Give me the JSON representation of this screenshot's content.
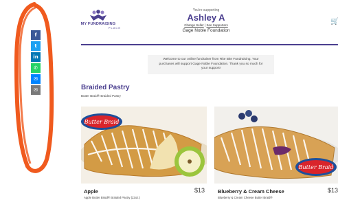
{
  "share": {
    "buttons": [
      {
        "icon": "facebook-icon",
        "glyph": "f",
        "color": "#3b5998"
      },
      {
        "icon": "twitter-icon",
        "glyph": "t",
        "color": "#1da1f2"
      },
      {
        "icon": "linkedin-icon",
        "glyph": "in",
        "color": "#0077b5"
      },
      {
        "icon": "whatsapp-icon",
        "glyph": "✆",
        "color": "#25d366"
      },
      {
        "icon": "messenger-icon",
        "glyph": "✉",
        "color": "#0084ff"
      },
      {
        "icon": "email-icon",
        "glyph": "✉",
        "color": "#7a7a7a"
      }
    ]
  },
  "header": {
    "logo_text": "MY FUNDRAISING",
    "logo_sub": "PLACE",
    "supporting_label": "You're supporting",
    "seller_name": "Ashley A",
    "change_seller": "Change Seller",
    "separator": "|",
    "see_supporters": "See Supporters",
    "organization": "Gage Noble Foundation",
    "cart_icon": "cart-icon"
  },
  "welcome": {
    "line1": "Welcome to our online fundraiser from Rite Bite Fundraising. Your",
    "line2": "purchases will support Gage Noble Foundation. Thank you so much for",
    "line3": "your support!"
  },
  "section": {
    "title": "Braided Pastry",
    "subtitle": "Butter Braid® Braided Pastry"
  },
  "products": [
    {
      "name": "Apple",
      "price": "$13",
      "description": "Apple Butter Braid® Braided Pastry (22oz.)",
      "badge": "Butter Braid"
    },
    {
      "name": "Blueberry & Cream Cheese",
      "price": "$13",
      "description": "Blueberry & Cream Cheese Butter Braid®",
      "badge": "Butter Braid"
    }
  ],
  "colors": {
    "brand": "#4b3f8f",
    "highlight": "#f05a1e"
  }
}
